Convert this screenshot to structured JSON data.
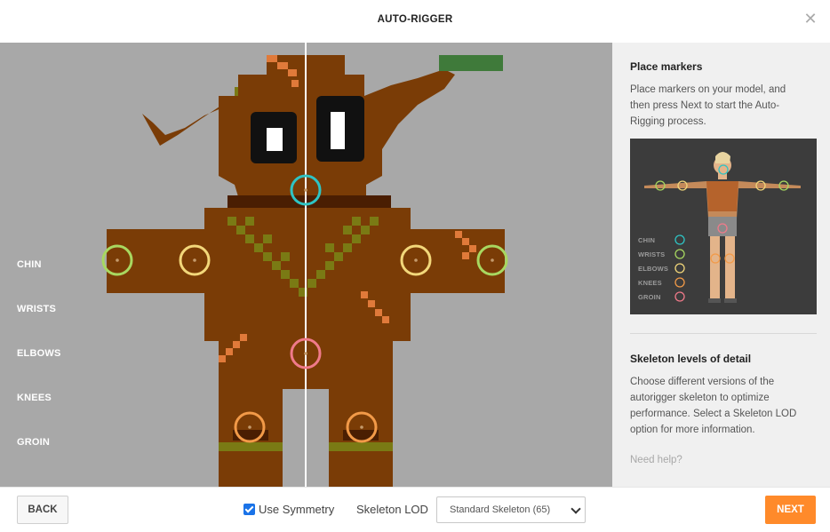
{
  "header": {
    "title": "AUTO-RIGGER",
    "close_icon": "close-icon"
  },
  "markers": {
    "labels": [
      "CHIN",
      "WRISTS",
      "ELBOWS",
      "KNEES",
      "GROIN"
    ],
    "colors": {
      "chin": "#2ec4c4",
      "wrists": "#a8d860",
      "elbows": "#f2d77a",
      "knees": "#f29a48",
      "groin": "#f07a8a"
    }
  },
  "sidebar": {
    "place_title": "Place markers",
    "place_text": "Place markers on your model, and then press Next to start the Auto-Rigging process.",
    "preview_legend": [
      "CHIN",
      "WRISTS",
      "ELBOWS",
      "KNEES",
      "GROIN"
    ],
    "lod_title": "Skeleton levels of detail",
    "lod_text": "Choose different versions of the autorigger skeleton to optimize performance. Select a Skeleton LOD option for more information.",
    "help": "Need help?"
  },
  "footer": {
    "back_label": "BACK",
    "symmetry_label": "Use Symmetry",
    "symmetry_checked": true,
    "lod_label": "Skeleton LOD",
    "lod_selected": "Standard Skeleton (65)",
    "next_label": "NEXT"
  },
  "colors": {
    "accent": "#ff8a2a",
    "viewport_bg": "#a8a8a8",
    "model_brown": "#7a3c06",
    "model_olive": "#7a7a14"
  }
}
